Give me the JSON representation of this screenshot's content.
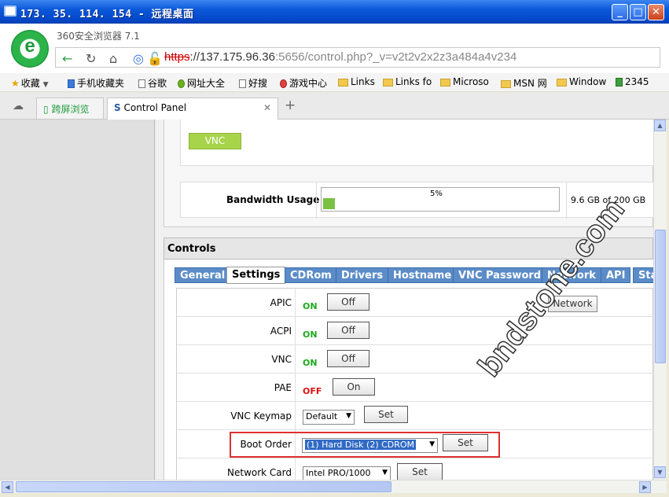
{
  "window": {
    "title": "173. 35. 114. 154 - 远程桌面"
  },
  "browser": {
    "name": "360安全浏览器 7.1",
    "url_proto": "https",
    "url_host": "://137.175.96.36",
    "url_rest": ":5656/control.php?_v=v2t2v2x2z3a484a4v234"
  },
  "bookmarks": [
    {
      "label": "收藏",
      "icon": "star-icon"
    },
    {
      "label": "手机收藏夹",
      "icon": "phone-icon"
    },
    {
      "label": "谷歌",
      "icon": "page-icon"
    },
    {
      "label": "网址大全",
      "icon": "globe-icon"
    },
    {
      "label": "好搜",
      "icon": "page-icon"
    },
    {
      "label": "游戏中心",
      "icon": "game-icon"
    },
    {
      "label": "Links",
      "icon": "folder-icon"
    },
    {
      "label": "Links fo",
      "icon": "folder-icon"
    },
    {
      "label": "Microso",
      "icon": "folder-icon"
    },
    {
      "label": "MSN 网",
      "icon": "folder-icon"
    },
    {
      "label": "Window",
      "icon": "folder-icon"
    },
    {
      "label": "2345",
      "icon": "site-icon"
    }
  ],
  "tabs": [
    {
      "label": "跨屏浏览"
    },
    {
      "label": "Control Panel"
    }
  ],
  "vps": {
    "vnc_button": "VNC",
    "bandwidth_label": "Bandwidth Usage",
    "bandwidth_percent": "5%",
    "bandwidth_fraction": 0.05,
    "bandwidth_text": "9.6 GB of 200 GB"
  },
  "controls": {
    "heading": "Controls",
    "tabs": [
      "General",
      "Settings",
      "CDRom",
      "Drivers",
      "Hostname",
      "VNC Password",
      "Network",
      "API",
      "Sta"
    ],
    "network_button": "Network",
    "rows": [
      {
        "label": "APIC",
        "state": "ON",
        "button": "Off"
      },
      {
        "label": "ACPI",
        "state": "ON",
        "button": "Off"
      },
      {
        "label": "VNC",
        "state": "ON",
        "button": "Off"
      },
      {
        "label": "PAE",
        "state": "OFF",
        "button": "On"
      }
    ],
    "vnc_keymap": {
      "label": "VNC Keymap",
      "value": "Default",
      "button": "Set"
    },
    "boot_order": {
      "label": "Boot Order",
      "value": "(1) Hard Disk (2) CDROM",
      "button": "Set"
    },
    "network_card": {
      "label": "Network Card",
      "value": "Intel PRO/1000",
      "button": "Set"
    }
  },
  "watermark": "bndstone.com"
}
